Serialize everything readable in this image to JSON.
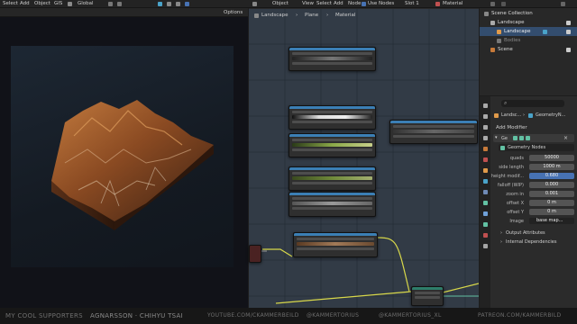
{
  "topbar": {
    "left_menu": [
      "Select",
      "Add",
      "Object",
      "GIS"
    ],
    "transform_orientation": "Global",
    "node_menu": [
      "Object",
      "View",
      "Select",
      "Add",
      "Node"
    ],
    "use_nodes_label": "Use Nodes",
    "slot_label": "Slot 1",
    "material_label": "Material",
    "options_label": "Options"
  },
  "node_editor": {
    "breadcrumb": [
      "Landscape",
      "Plane",
      "Material"
    ]
  },
  "outliner": {
    "rows": [
      {
        "label": "Scene Collection"
      },
      {
        "label": "Landscape"
      },
      {
        "label": "Landscape"
      },
      {
        "label": "Bodies"
      },
      {
        "label": "Scene"
      }
    ]
  },
  "properties": {
    "search_placeholder": "",
    "breadcrumb": [
      "Landsc...",
      "GeometryN..."
    ],
    "add_modifier_label": "Add Modifier",
    "modifier_short": "Ge",
    "modifier_name": "Geometry Nodes",
    "fields": [
      {
        "label": "quads",
        "value": "50000"
      },
      {
        "label": "side length",
        "value": "1000 m"
      },
      {
        "label": "height modif...",
        "value": "0.680"
      },
      {
        "label": "falloff (WIP)",
        "value": "0.000"
      },
      {
        "label": "zoom in",
        "value": "0.001"
      },
      {
        "label": "offset X",
        "value": "0 m"
      },
      {
        "label": "offset Y",
        "value": "0 m"
      },
      {
        "label": "Image",
        "value": "base map..."
      }
    ],
    "sections": [
      "Output Attributes",
      "Internal Dependencies"
    ]
  },
  "footer": {
    "items": [
      "MY COOL SUPPORTERS",
      "AGNARSSON · CHIHYU TSAI",
      "YOUTUBE.COM/CKAMMERBEILD",
      "@KAMMERTORIUS",
      "@KAMMERTORIUS_XL",
      "PATREON.COM/KAMMERBILD"
    ]
  },
  "colors": {
    "accent": "#4772b3",
    "node_header": "#3b7fb5",
    "wire_yellow": "#d8d84a"
  }
}
